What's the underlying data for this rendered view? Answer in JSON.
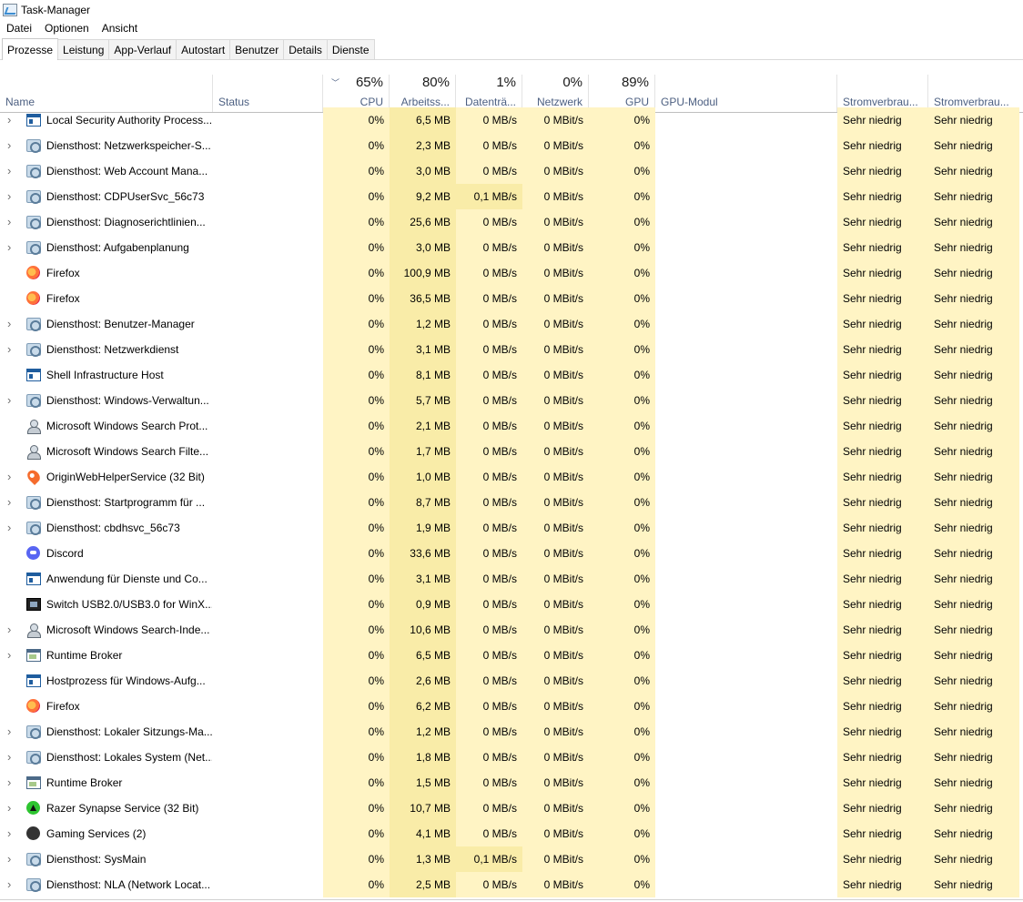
{
  "window": {
    "title": "Task-Manager"
  },
  "menu": [
    "Datei",
    "Optionen",
    "Ansicht"
  ],
  "tabs": [
    {
      "label": "Prozesse",
      "active": true
    },
    {
      "label": "Leistung",
      "active": false
    },
    {
      "label": "App-Verlauf",
      "active": false
    },
    {
      "label": "Autostart",
      "active": false
    },
    {
      "label": "Benutzer",
      "active": false
    },
    {
      "label": "Details",
      "active": false
    },
    {
      "label": "Dienste",
      "active": false
    }
  ],
  "columns": {
    "name": "Name",
    "status": "Status",
    "cpu": {
      "label": "CPU",
      "percent": "65%"
    },
    "memory": {
      "label": "Arbeitss...",
      "percent": "80%"
    },
    "disk": {
      "label": "Datenträ...",
      "percent": "1%"
    },
    "network": {
      "label": "Netzwerk",
      "percent": "0%"
    },
    "gpu": {
      "label": "GPU",
      "percent": "89%"
    },
    "gpu_engine": {
      "label": "GPU-Modul"
    },
    "power": {
      "label": "Stromverbrau..."
    },
    "power_trend": {
      "label": "Stromverbrau..."
    }
  },
  "colors": {
    "heat_light": "#fff4c4",
    "heat_medium": "#f9eca8",
    "header_text": "#4d6082"
  },
  "processes": [
    {
      "name": "Local Security Authority Process...",
      "icon": "window-icon",
      "expandable": true,
      "cpu": "0%",
      "memory": "6,5 MB",
      "disk": "0 MB/s",
      "network": "0 MBit/s",
      "gpu": "0%",
      "power": "Sehr niedrig",
      "power_trend": "Sehr niedrig"
    },
    {
      "name": "Diensthost: Netzwerkspeicher-S...",
      "icon": "gear-icon",
      "expandable": true,
      "cpu": "0%",
      "memory": "2,3 MB",
      "disk": "0 MB/s",
      "network": "0 MBit/s",
      "gpu": "0%",
      "power": "Sehr niedrig",
      "power_trend": "Sehr niedrig"
    },
    {
      "name": "Diensthost: Web Account Mana...",
      "icon": "gear-icon",
      "expandable": true,
      "cpu": "0%",
      "memory": "3,0 MB",
      "disk": "0 MB/s",
      "network": "0 MBit/s",
      "gpu": "0%",
      "power": "Sehr niedrig",
      "power_trend": "Sehr niedrig"
    },
    {
      "name": "Diensthost: CDPUserSvc_56c73",
      "icon": "gear-icon",
      "expandable": true,
      "cpu": "0%",
      "memory": "9,2 MB",
      "disk": "0,1 MB/s",
      "disk_hot": true,
      "network": "0 MBit/s",
      "gpu": "0%",
      "power": "Sehr niedrig",
      "power_trend": "Sehr niedrig"
    },
    {
      "name": "Diensthost: Diagnoserichtlinien...",
      "icon": "gear-icon",
      "expandable": true,
      "cpu": "0%",
      "memory": "25,6 MB",
      "disk": "0 MB/s",
      "network": "0 MBit/s",
      "gpu": "0%",
      "power": "Sehr niedrig",
      "power_trend": "Sehr niedrig"
    },
    {
      "name": "Diensthost: Aufgabenplanung",
      "icon": "gear-icon",
      "expandable": true,
      "cpu": "0%",
      "memory": "3,0 MB",
      "disk": "0 MB/s",
      "network": "0 MBit/s",
      "gpu": "0%",
      "power": "Sehr niedrig",
      "power_trend": "Sehr niedrig"
    },
    {
      "name": "Firefox",
      "icon": "firefox-icon",
      "expandable": false,
      "cpu": "0%",
      "memory": "100,9 MB",
      "disk": "0 MB/s",
      "network": "0 MBit/s",
      "gpu": "0%",
      "power": "Sehr niedrig",
      "power_trend": "Sehr niedrig"
    },
    {
      "name": "Firefox",
      "icon": "firefox-icon",
      "expandable": false,
      "cpu": "0%",
      "memory": "36,5 MB",
      "disk": "0 MB/s",
      "network": "0 MBit/s",
      "gpu": "0%",
      "power": "Sehr niedrig",
      "power_trend": "Sehr niedrig"
    },
    {
      "name": "Diensthost: Benutzer-Manager",
      "icon": "gear-icon",
      "expandable": true,
      "cpu": "0%",
      "memory": "1,2 MB",
      "disk": "0 MB/s",
      "network": "0 MBit/s",
      "gpu": "0%",
      "power": "Sehr niedrig",
      "power_trend": "Sehr niedrig"
    },
    {
      "name": "Diensthost: Netzwerkdienst",
      "icon": "gear-icon",
      "expandable": true,
      "cpu": "0%",
      "memory": "3,1 MB",
      "disk": "0 MB/s",
      "network": "0 MBit/s",
      "gpu": "0%",
      "power": "Sehr niedrig",
      "power_trend": "Sehr niedrig"
    },
    {
      "name": "Shell Infrastructure Host",
      "icon": "window-icon",
      "expandable": false,
      "cpu": "0%",
      "memory": "8,1 MB",
      "disk": "0 MB/s",
      "network": "0 MBit/s",
      "gpu": "0%",
      "power": "Sehr niedrig",
      "power_trend": "Sehr niedrig"
    },
    {
      "name": "Diensthost: Windows-Verwaltun...",
      "icon": "gear-icon",
      "expandable": true,
      "cpu": "0%",
      "memory": "5,7 MB",
      "disk": "0 MB/s",
      "network": "0 MBit/s",
      "gpu": "0%",
      "power": "Sehr niedrig",
      "power_trend": "Sehr niedrig"
    },
    {
      "name": "Microsoft Windows Search Prot...",
      "icon": "search-icon",
      "expandable": false,
      "cpu": "0%",
      "memory": "2,1 MB",
      "disk": "0 MB/s",
      "network": "0 MBit/s",
      "gpu": "0%",
      "power": "Sehr niedrig",
      "power_trend": "Sehr niedrig"
    },
    {
      "name": "Microsoft Windows Search Filte...",
      "icon": "search-icon",
      "expandable": false,
      "cpu": "0%",
      "memory": "1,7 MB",
      "disk": "0 MB/s",
      "network": "0 MBit/s",
      "gpu": "0%",
      "power": "Sehr niedrig",
      "power_trend": "Sehr niedrig"
    },
    {
      "name": "OriginWebHelperService (32 Bit)",
      "icon": "origin-icon",
      "expandable": true,
      "cpu": "0%",
      "memory": "1,0 MB",
      "disk": "0 MB/s",
      "network": "0 MBit/s",
      "gpu": "0%",
      "power": "Sehr niedrig",
      "power_trend": "Sehr niedrig"
    },
    {
      "name": "Diensthost: Startprogramm für ...",
      "icon": "gear-icon",
      "expandable": true,
      "cpu": "0%",
      "memory": "8,7 MB",
      "disk": "0 MB/s",
      "network": "0 MBit/s",
      "gpu": "0%",
      "power": "Sehr niedrig",
      "power_trend": "Sehr niedrig"
    },
    {
      "name": "Diensthost: cbdhsvc_56c73",
      "icon": "gear-icon",
      "expandable": true,
      "cpu": "0%",
      "memory": "1,9 MB",
      "disk": "0 MB/s",
      "network": "0 MBit/s",
      "gpu": "0%",
      "power": "Sehr niedrig",
      "power_trend": "Sehr niedrig"
    },
    {
      "name": "Discord",
      "icon": "discord-icon",
      "expandable": false,
      "cpu": "0%",
      "memory": "33,6 MB",
      "disk": "0 MB/s",
      "network": "0 MBit/s",
      "gpu": "0%",
      "power": "Sehr niedrig",
      "power_trend": "Sehr niedrig"
    },
    {
      "name": "Anwendung für Dienste und Co...",
      "icon": "window-icon",
      "expandable": false,
      "cpu": "0%",
      "memory": "3,1 MB",
      "disk": "0 MB/s",
      "network": "0 MBit/s",
      "gpu": "0%",
      "power": "Sehr niedrig",
      "power_trend": "Sehr niedrig"
    },
    {
      "name": "Switch USB2.0/USB3.0 for WinX...",
      "icon": "switch-icon",
      "expandable": false,
      "cpu": "0%",
      "memory": "0,9 MB",
      "disk": "0 MB/s",
      "network": "0 MBit/s",
      "gpu": "0%",
      "power": "Sehr niedrig",
      "power_trend": "Sehr niedrig"
    },
    {
      "name": "Microsoft Windows Search-Inde...",
      "icon": "search-icon",
      "expandable": true,
      "cpu": "0%",
      "memory": "10,6 MB",
      "disk": "0 MB/s",
      "network": "0 MBit/s",
      "gpu": "0%",
      "power": "Sehr niedrig",
      "power_trend": "Sehr niedrig"
    },
    {
      "name": "Runtime Broker",
      "icon": "broker-icon",
      "expandable": true,
      "cpu": "0%",
      "memory": "6,5 MB",
      "disk": "0 MB/s",
      "network": "0 MBit/s",
      "gpu": "0%",
      "power": "Sehr niedrig",
      "power_trend": "Sehr niedrig"
    },
    {
      "name": "Hostprozess für Windows-Aufg...",
      "icon": "window-icon",
      "expandable": false,
      "cpu": "0%",
      "memory": "2,6 MB",
      "disk": "0 MB/s",
      "network": "0 MBit/s",
      "gpu": "0%",
      "power": "Sehr niedrig",
      "power_trend": "Sehr niedrig"
    },
    {
      "name": "Firefox",
      "icon": "firefox-icon",
      "expandable": false,
      "cpu": "0%",
      "memory": "6,2 MB",
      "disk": "0 MB/s",
      "network": "0 MBit/s",
      "gpu": "0%",
      "power": "Sehr niedrig",
      "power_trend": "Sehr niedrig"
    },
    {
      "name": "Diensthost: Lokaler Sitzungs-Ma...",
      "icon": "gear-icon",
      "expandable": true,
      "cpu": "0%",
      "memory": "1,2 MB",
      "disk": "0 MB/s",
      "network": "0 MBit/s",
      "gpu": "0%",
      "power": "Sehr niedrig",
      "power_trend": "Sehr niedrig"
    },
    {
      "name": "Diensthost: Lokales System (Net...",
      "icon": "gear-icon",
      "expandable": true,
      "cpu": "0%",
      "memory": "1,8 MB",
      "disk": "0 MB/s",
      "network": "0 MBit/s",
      "gpu": "0%",
      "power": "Sehr niedrig",
      "power_trend": "Sehr niedrig"
    },
    {
      "name": "Runtime Broker",
      "icon": "broker-icon",
      "expandable": true,
      "cpu": "0%",
      "memory": "1,5 MB",
      "disk": "0 MB/s",
      "network": "0 MBit/s",
      "gpu": "0%",
      "power": "Sehr niedrig",
      "power_trend": "Sehr niedrig"
    },
    {
      "name": "Razer Synapse Service (32 Bit)",
      "icon": "razer-icon",
      "expandable": true,
      "cpu": "0%",
      "memory": "10,7 MB",
      "disk": "0 MB/s",
      "network": "0 MBit/s",
      "gpu": "0%",
      "power": "Sehr niedrig",
      "power_trend": "Sehr niedrig"
    },
    {
      "name": "Gaming Services (2)",
      "icon": "xbox-icon",
      "expandable": true,
      "cpu": "0%",
      "memory": "4,1 MB",
      "disk": "0 MB/s",
      "network": "0 MBit/s",
      "gpu": "0%",
      "power": "Sehr niedrig",
      "power_trend": "Sehr niedrig"
    },
    {
      "name": "Diensthost: SysMain",
      "icon": "gear-icon",
      "expandable": true,
      "cpu": "0%",
      "memory": "1,3 MB",
      "disk": "0,1 MB/s",
      "disk_hot": true,
      "network": "0 MBit/s",
      "gpu": "0%",
      "power": "Sehr niedrig",
      "power_trend": "Sehr niedrig"
    },
    {
      "name": "Diensthost: NLA (Network Locat...",
      "icon": "gear-icon",
      "expandable": true,
      "cpu": "0%",
      "memory": "2,5 MB",
      "disk": "0 MB/s",
      "network": "0 MBit/s",
      "gpu": "0%",
      "power": "Sehr niedrig",
      "power_trend": "Sehr niedrig"
    }
  ]
}
